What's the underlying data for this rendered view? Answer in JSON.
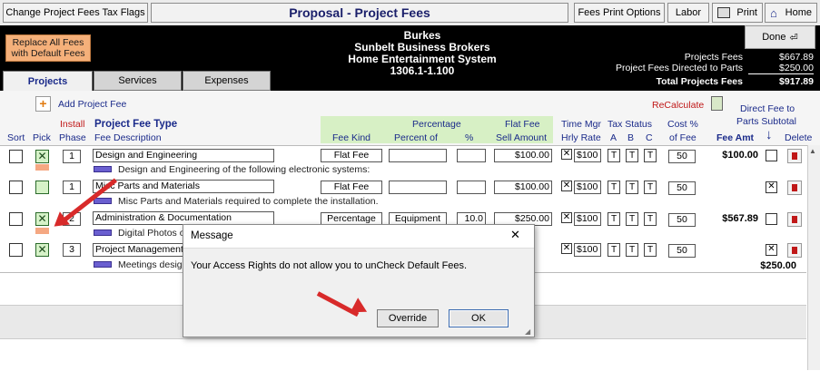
{
  "topbar": {
    "change_flags": "Change Project Fees Tax Flags",
    "title": "Proposal - Project Fees",
    "fees_print_options": "Fees Print Options",
    "labor": "Labor",
    "print": "Print",
    "home": "Home"
  },
  "header": {
    "replace_btn": "Replace All Fees with Default Fees",
    "client": "Burkes",
    "company": "Sunbelt Business Brokers",
    "system": "Home Entertainment System",
    "code": "1306.1-1.100",
    "done": "Done",
    "fees_rows": [
      {
        "label": "Projects Fees",
        "value": "$667.89"
      },
      {
        "label": "Project Fees Directed to Parts",
        "value": "$250.00"
      }
    ],
    "total_label": "Total Projects Fees",
    "total_value": "$917.89"
  },
  "tabs": [
    "Projects",
    "Services",
    "Expenses"
  ],
  "actions": {
    "add_fee": "Add Project Fee",
    "recalculate": "ReCalculate",
    "direct_fee_1": "Direct Fee to",
    "direct_fee_2": "Parts Subtotal"
  },
  "columns": {
    "sort": "Sort",
    "pick": "Pick",
    "install": "Install",
    "phase": "Phase",
    "fee_type": "Project Fee Type",
    "fee_desc": "Fee Description",
    "fee_kind": "Fee Kind",
    "percentage": "Percentage",
    "percent_of": "Percent of",
    "pct": "%",
    "flat_fee": "Flat Fee",
    "sell_amount": "Sell Amount",
    "time_mgr": "Time Mgr",
    "hrly_rate": "Hrly Rate",
    "tax_status": "Tax Status",
    "tax_a": "A",
    "tax_b": "B",
    "tax_c": "C",
    "cost_pct": "Cost %",
    "of_fee": "of Fee",
    "fee_amt": "Fee Amt",
    "delete": "Delete"
  },
  "rows": [
    {
      "phase": "1",
      "type": "Design and Engineering",
      "desc": "Design and Engineering of  the following electronic systems:",
      "kind": "Flat Fee",
      "percent_of": "",
      "pct": "",
      "sell": "$100.00",
      "rate": "$100",
      "a": "T",
      "b": "T",
      "c": "T",
      "cost": "50",
      "amt": "$100.00",
      "picked": true
    },
    {
      "phase": "1",
      "type": "Misc Parts and Materials",
      "desc": "Misc Parts and Materials required to complete the installation.",
      "kind": "Flat Fee",
      "percent_of": "",
      "pct": "",
      "sell": "$100.00",
      "rate": "$100",
      "a": "T",
      "b": "T",
      "c": "T",
      "cost": "50",
      "amt": "",
      "picked": false
    },
    {
      "phase": "2",
      "type": "Administration & Documentation",
      "desc": "Digital Photos o",
      "kind": "Percentage",
      "percent_of": "Equipment",
      "pct": "10.0",
      "sell": "$250.00",
      "rate": "$100",
      "a": "T",
      "b": "T",
      "c": "T",
      "cost": "50",
      "amt": "$567.89",
      "picked": true
    },
    {
      "phase": "3",
      "type": "Project Management",
      "desc": "Meetings desig",
      "kind": "",
      "percent_of": "",
      "pct": "",
      "sell": "",
      "rate": "$100",
      "a": "T",
      "b": "T",
      "c": "T",
      "cost": "50",
      "amt": "$250.00",
      "picked": true
    }
  ],
  "dialog": {
    "title": "Message",
    "close": "✕",
    "message": "Your Access Rights do not allow you to unCheck Default Fees.",
    "override": "Override",
    "ok": "OK"
  }
}
